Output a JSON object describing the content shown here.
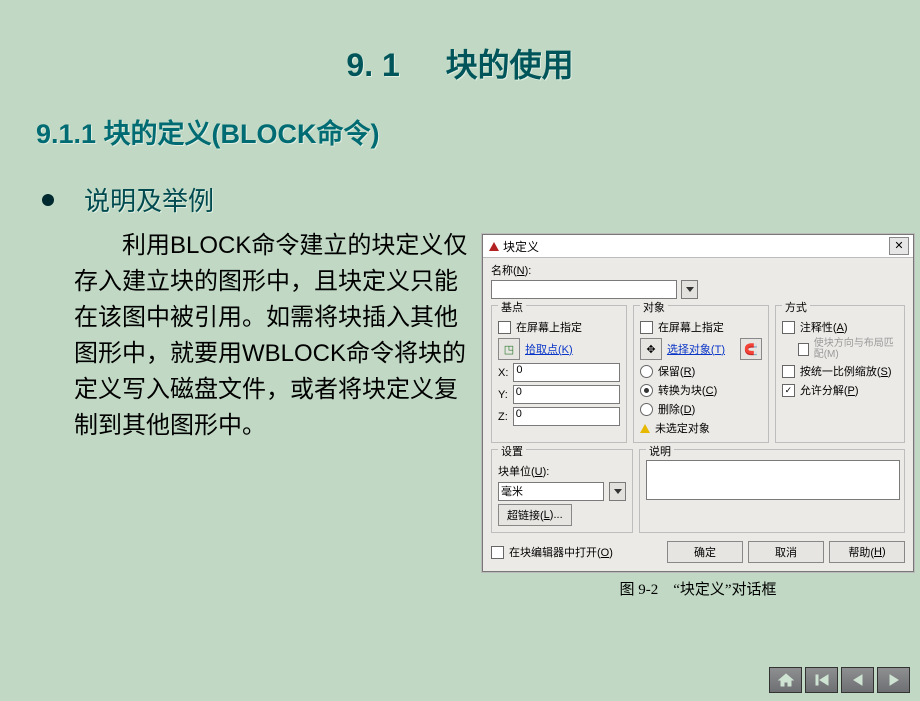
{
  "title_left": "9. 1",
  "title_right": "块的使用",
  "subhead": "9.1.1 块的定义(BLOCK命令)",
  "bullet": "说明及举例",
  "paragraph": "利用BLOCK命令建立的块定义仅存入建立块的图形中，且块定义只能在该图中被引用。如需将块插入其他图形中，就要用WBLOCK命令将块的定义写入磁盘文件，或者将块定义复制到其他图形中。",
  "dialog": {
    "title": "块定义",
    "name_label_prefix": "名称(",
    "name_label_under": "N",
    "name_label_suffix": "):",
    "groups": {
      "base": {
        "title": "基点",
        "onscreen": "在屏幕上指定",
        "pick_prefix": "拾取点(",
        "pick_under": "K",
        "pick_suffix": ")",
        "x_label": "X:",
        "y_label": "Y:",
        "z_label": "Z:",
        "x_val": "0",
        "y_val": "0",
        "z_val": "0"
      },
      "objects": {
        "title": "对象",
        "onscreen": "在屏幕上指定",
        "select_prefix": "选择对象(",
        "select_under": "T",
        "select_suffix": ")",
        "retain_prefix": "保留(",
        "retain_under": "R",
        "retain_suffix": ")",
        "convert_prefix": "转换为块(",
        "convert_under": "C",
        "convert_suffix": ")",
        "delete_prefix": "删除(",
        "delete_under": "D",
        "delete_suffix": ")",
        "none_selected": "未选定对象"
      },
      "mode": {
        "title": "方式",
        "annotative_prefix": "注释性(",
        "annotative_under": "A",
        "annotative_suffix": ")",
        "match_layout": "使块方向与布局匹配(M)",
        "uniform_prefix": "按统一比例缩放(",
        "uniform_under": "S",
        "uniform_suffix": ")",
        "explode_prefix": "允许分解(",
        "explode_under": "P",
        "explode_suffix": ")"
      },
      "settings": {
        "title": "设置",
        "unit_label_prefix": "块单位(",
        "unit_label_under": "U",
        "unit_label_suffix": "):",
        "unit_value": "毫米",
        "hyperlink_prefix": "超链接(",
        "hyperlink_under": "L",
        "hyperlink_suffix": ")..."
      },
      "desc": {
        "title": "说明"
      }
    },
    "open_editor_prefix": "在块编辑器中打开(",
    "open_editor_under": "O",
    "open_editor_suffix": ")",
    "ok": "确定",
    "cancel": "取消",
    "help_prefix": "帮助(",
    "help_under": "H",
    "help_suffix": ")"
  },
  "caption": "图 9-2　“块定义”对话框",
  "nav": {
    "home": "home-icon",
    "prev": "prev-icon",
    "next": "next-icon",
    "end": "end-icon"
  }
}
